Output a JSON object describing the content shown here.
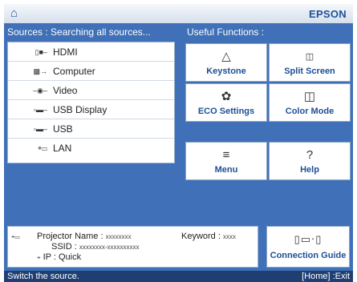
{
  "header": {
    "brand": "EPSON",
    "home_icon": "home-icon"
  },
  "sources": {
    "heading": "Sources : Searching all sources...",
    "items": [
      {
        "label": "HDMI",
        "icon": "hdmi-icon"
      },
      {
        "label": "Computer",
        "icon": "computer-port-icon"
      },
      {
        "label": "Video",
        "icon": "video-port-icon"
      },
      {
        "label": "USB Display",
        "icon": "usb-display-icon"
      },
      {
        "label": "USB",
        "icon": "usb-icon"
      },
      {
        "label": "LAN",
        "icon": "lan-icon"
      }
    ]
  },
  "useful": {
    "heading": "Useful Functions :",
    "buttons": [
      {
        "label": "Keystone",
        "icon": "keystone-icon"
      },
      {
        "label": "Split Screen",
        "icon": "split-screen-icon"
      },
      {
        "label": "ECO Settings",
        "icon": "eco-leaf-icon"
      },
      {
        "label": "Color Mode",
        "icon": "color-mode-icon"
      },
      {
        "label": "Menu",
        "icon": "menu-icon"
      },
      {
        "label": "Help",
        "icon": "help-icon"
      }
    ]
  },
  "info": {
    "projector_name_label": "Projector Name :",
    "projector_name_value": "xxxxxxxx",
    "ssid_label": "SSID :",
    "ssid_value": "xxxxxxxx-xxxxxxxxxx",
    "ip_label": "IP :",
    "ip_value": "Quick",
    "keyword_label": "Keyword :",
    "keyword_value": "xxxx"
  },
  "connection_guide": {
    "label": "Connection Guide",
    "icon": "connection-guide-icon"
  },
  "status": {
    "left": "Switch the source.",
    "right": "[Home] :Exit"
  }
}
